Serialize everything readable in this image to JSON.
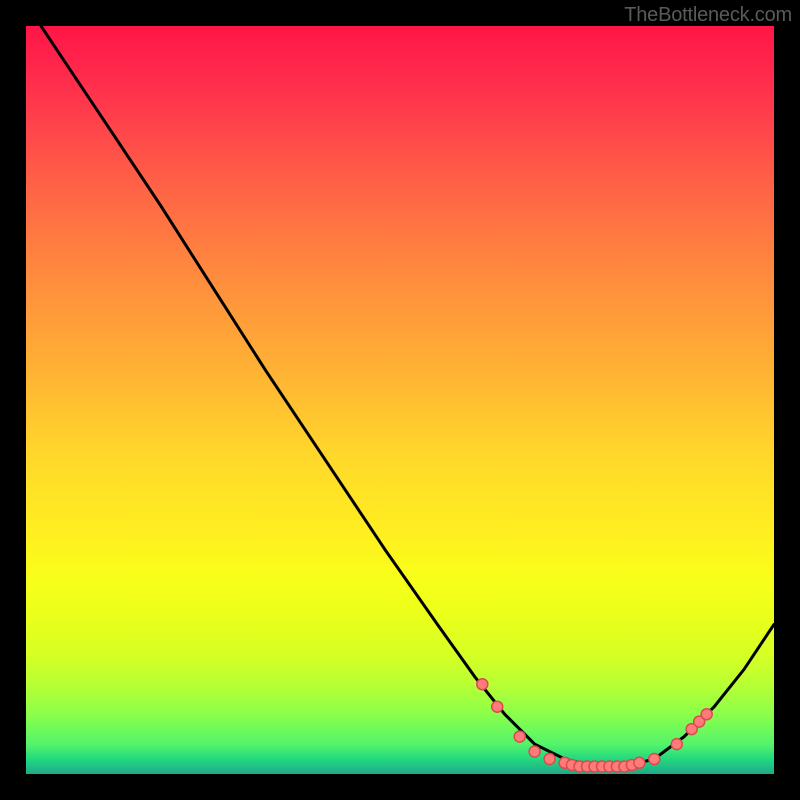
{
  "watermark": "TheBottleneck.com",
  "chart_data": {
    "type": "line",
    "title": "",
    "xlabel": "",
    "ylabel": "",
    "xlim": [
      0,
      100
    ],
    "ylim": [
      0,
      100
    ],
    "grid": false,
    "legend": false,
    "curve_points": [
      {
        "x": 2,
        "y": 100
      },
      {
        "x": 6,
        "y": 94
      },
      {
        "x": 12,
        "y": 85
      },
      {
        "x": 18,
        "y": 76
      },
      {
        "x": 25,
        "y": 65
      },
      {
        "x": 32,
        "y": 54
      },
      {
        "x": 40,
        "y": 42
      },
      {
        "x": 48,
        "y": 30
      },
      {
        "x": 55,
        "y": 20
      },
      {
        "x": 60,
        "y": 13
      },
      {
        "x": 64,
        "y": 8
      },
      {
        "x": 68,
        "y": 4
      },
      {
        "x": 72,
        "y": 2
      },
      {
        "x": 76,
        "y": 1
      },
      {
        "x": 80,
        "y": 1
      },
      {
        "x": 84,
        "y": 2
      },
      {
        "x": 88,
        "y": 5
      },
      {
        "x": 92,
        "y": 9
      },
      {
        "x": 96,
        "y": 14
      },
      {
        "x": 100,
        "y": 20
      }
    ],
    "marker_points": [
      {
        "x": 61,
        "y": 12
      },
      {
        "x": 63,
        "y": 9
      },
      {
        "x": 66,
        "y": 5
      },
      {
        "x": 68,
        "y": 3
      },
      {
        "x": 70,
        "y": 2
      },
      {
        "x": 72,
        "y": 1.5
      },
      {
        "x": 73,
        "y": 1.2
      },
      {
        "x": 74,
        "y": 1
      },
      {
        "x": 75,
        "y": 1
      },
      {
        "x": 76,
        "y": 1
      },
      {
        "x": 77,
        "y": 1
      },
      {
        "x": 78,
        "y": 1
      },
      {
        "x": 79,
        "y": 1
      },
      {
        "x": 80,
        "y": 1
      },
      {
        "x": 81,
        "y": 1.2
      },
      {
        "x": 82,
        "y": 1.5
      },
      {
        "x": 84,
        "y": 2
      },
      {
        "x": 87,
        "y": 4
      },
      {
        "x": 89,
        "y": 6
      },
      {
        "x": 90,
        "y": 7
      },
      {
        "x": 91,
        "y": 8
      }
    ],
    "gradient_stops": [
      {
        "pos": 0,
        "color": "#ff1547"
      },
      {
        "pos": 8,
        "color": "#ff2f4d"
      },
      {
        "pos": 20,
        "color": "#ff5d47"
      },
      {
        "pos": 33,
        "color": "#ff8a3e"
      },
      {
        "pos": 46,
        "color": "#ffb234"
      },
      {
        "pos": 58,
        "color": "#ffd92a"
      },
      {
        "pos": 68,
        "color": "#ffef20"
      },
      {
        "pos": 74,
        "color": "#f8ff19"
      },
      {
        "pos": 79,
        "color": "#eaff1b"
      },
      {
        "pos": 84,
        "color": "#d6ff24"
      },
      {
        "pos": 88,
        "color": "#b8ff33"
      },
      {
        "pos": 92,
        "color": "#8bff4a"
      },
      {
        "pos": 96,
        "color": "#54f46a"
      },
      {
        "pos": 98,
        "color": "#22d97e"
      },
      {
        "pos": 100,
        "color": "#1fa88a"
      }
    ]
  }
}
